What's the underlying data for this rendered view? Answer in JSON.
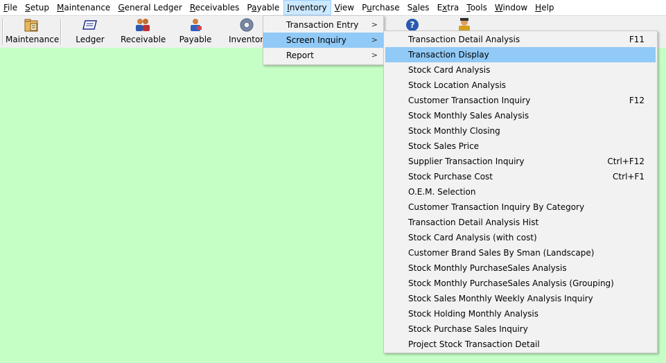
{
  "menubar": {
    "items": [
      {
        "acc": "F",
        "rest": "ile",
        "pre": ""
      },
      {
        "acc": "S",
        "rest": "etup",
        "pre": ""
      },
      {
        "acc": "M",
        "rest": "aintenance",
        "pre": ""
      },
      {
        "acc": "G",
        "rest": "eneral Ledger",
        "pre": ""
      },
      {
        "acc": "R",
        "rest": "eceivables",
        "pre": ""
      },
      {
        "acc": "a",
        "rest": "yable",
        "pre": "P"
      },
      {
        "acc": "I",
        "rest": "nventory",
        "pre": ""
      },
      {
        "acc": "V",
        "rest": "iew",
        "pre": ""
      },
      {
        "acc": "u",
        "rest": "rchase",
        "pre": "P"
      },
      {
        "acc": "a",
        "rest": "les",
        "pre": "S"
      },
      {
        "acc": "x",
        "rest": "tra",
        "pre": "E"
      },
      {
        "acc": "T",
        "rest": "ools",
        "pre": ""
      },
      {
        "acc": "W",
        "rest": "indow",
        "pre": ""
      },
      {
        "acc": "H",
        "rest": "elp",
        "pre": ""
      }
    ]
  },
  "toolbar": {
    "maintenance": "Maintenance",
    "ledger": "Ledger",
    "receivable": "Receivable",
    "payable": "Payable",
    "inventory": "Inventory"
  },
  "inventory_menu": {
    "items": [
      "Transaction Entry",
      "Screen Inquiry",
      "Report"
    ],
    "arrow": ">"
  },
  "inquiry_menu": {
    "items": [
      {
        "label": "Transaction Detail Analysis",
        "key": "F11"
      },
      {
        "label": "Transaction Display",
        "key": ""
      },
      {
        "label": "Stock Card Analysis",
        "key": ""
      },
      {
        "label": "Stock Location Analysis",
        "key": ""
      },
      {
        "label": "Customer Transaction Inquiry",
        "key": "F12"
      },
      {
        "label": "Stock Monthly Sales Analysis",
        "key": ""
      },
      {
        "label": "Stock Monthly Closing",
        "key": ""
      },
      {
        "label": "Stock Sales Price",
        "key": ""
      },
      {
        "label": "Supplier Transaction Inquiry",
        "key": "Ctrl+F12"
      },
      {
        "label": "Stock Purchase Cost",
        "key": "Ctrl+F1"
      },
      {
        "label": "O.E.M. Selection",
        "key": ""
      },
      {
        "label": "Customer Transaction Inquiry By Category",
        "key": ""
      },
      {
        "label": "Transaction Detail Analysis Hist",
        "key": ""
      },
      {
        "label": "Stock Card Analysis (with cost)",
        "key": ""
      },
      {
        "label": "Customer Brand Sales By Sman (Landscape)",
        "key": ""
      },
      {
        "label": "Stock Monthly PurchaseSales Analysis",
        "key": ""
      },
      {
        "label": "Stock Monthly PurchaseSales Analysis (Grouping)",
        "key": ""
      },
      {
        "label": "Stock Sales Monthly Weekly Analysis Inquiry",
        "key": ""
      },
      {
        "label": "Stock Holding Monthly Analysis",
        "key": ""
      },
      {
        "label": "Stock Purchase Sales Inquiry",
        "key": ""
      },
      {
        "label": "Project Stock Transaction Detail",
        "key": ""
      }
    ]
  },
  "colors": {
    "workspace": "#c6ffc6",
    "menu_highlight": "#91c9f7",
    "menubar_active": "#cce8ff"
  },
  "icons": [
    "maintenance-folder-icon",
    "ledger-book-icon",
    "receivable-people-icon",
    "payable-person-icon",
    "inventory-gear-icon",
    "help-icon",
    "user-icon"
  ]
}
